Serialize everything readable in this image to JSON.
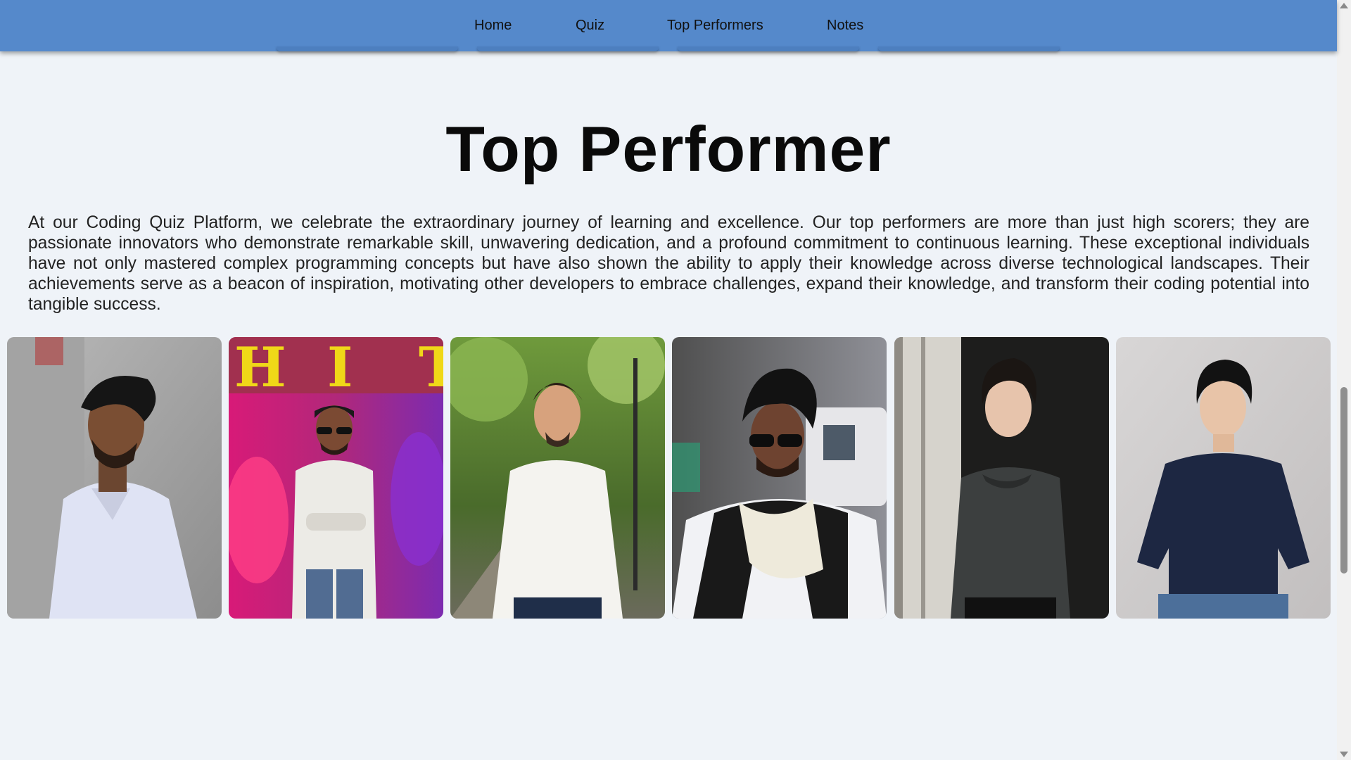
{
  "nav": {
    "items": [
      {
        "label": "Home"
      },
      {
        "label": "Quiz"
      },
      {
        "label": "Top Performers"
      },
      {
        "label": "Notes"
      }
    ]
  },
  "main": {
    "title": "Top Performer",
    "intro": "At our Coding Quiz Platform, we celebrate the extraordinary journey of learning and excellence. Our top performers are more than just high scorers; they are passionate innovators who demonstrate remarkable skill, unwavering dedication, and a profound commitment to continuous learning. These exceptional individuals have not only mastered complex programming concepts but have also shown the ability to apply their knowledge across diverse technological landscapes. Their achievements serve as a beacon of inspiration, motivating other developers to embrace challenges, expand their knowledge, and transform their coding potential into tangible success.",
    "gallery_banner_letters": [
      "H",
      "I",
      "T"
    ]
  },
  "colors": {
    "navbar": "#5589cb",
    "background": "#eff3f8",
    "heading": "#0a0a0a"
  }
}
